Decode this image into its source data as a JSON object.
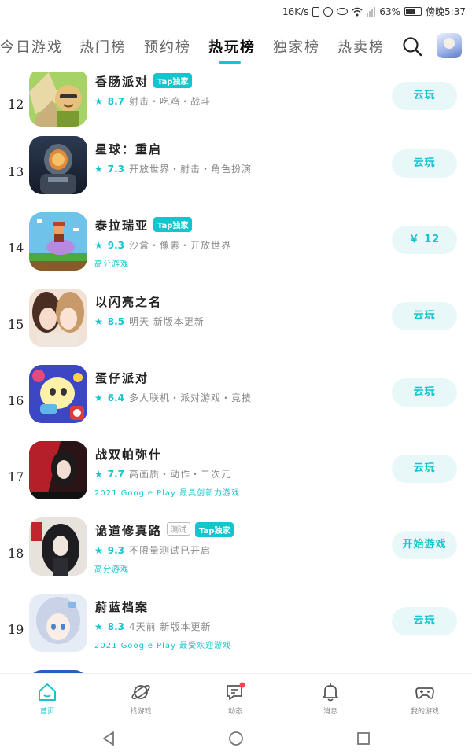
{
  "status_bar": {
    "speed": "16K/s",
    "battery_percent": "63%",
    "battery_level": 0.63,
    "time": "傍晚5:37"
  },
  "tabs": [
    {
      "label": "今日游戏",
      "active": false
    },
    {
      "label": "热门榜",
      "active": false
    },
    {
      "label": "预约榜",
      "active": false
    },
    {
      "label": "热玩榜",
      "active": true
    },
    {
      "label": "独家榜",
      "active": false
    },
    {
      "label": "热卖榜",
      "active": false
    }
  ],
  "colors": {
    "accent": "#15c5ce",
    "action_bg": "#e8f8f9"
  },
  "games": [
    {
      "rank": "12",
      "title": "香肠派对",
      "badge": "Tap独家",
      "score": "8.7",
      "tags": "射击・吃鸡・战斗",
      "extra": "",
      "action": "云玩"
    },
    {
      "rank": "13",
      "title": "星球：重启",
      "badge": "",
      "score": "7.3",
      "tags": "开放世界・射击・角色扮演",
      "extra": "",
      "action": "云玩"
    },
    {
      "rank": "14",
      "title": "泰拉瑞亚",
      "badge": "Tap独家",
      "score": "9.3",
      "tags": "沙盒・像素・开放世界",
      "extra": "高分游戏",
      "action": "￥ 12"
    },
    {
      "rank": "15",
      "title": "以闪亮之名",
      "badge": "",
      "score": "8.5",
      "tags": "明天 新版本更新",
      "extra": "",
      "action": "云玩"
    },
    {
      "rank": "16",
      "title": "蛋仔派对",
      "badge": "",
      "score": "6.4",
      "tags": "多人联机・派对游戏・竞技",
      "extra": "",
      "action": "云玩"
    },
    {
      "rank": "17",
      "title": "战双帕弥什",
      "badge": "",
      "score": "7.7",
      "tags": "高画质・动作・二次元",
      "extra": "2021 Google Play 最具创新力游戏",
      "action": "云玩"
    },
    {
      "rank": "18",
      "title": "诡道修真路",
      "badge": "Tap独家",
      "test_badge": "测试",
      "score": "9.3",
      "tags": "不限量测试已开启",
      "extra": "高分游戏",
      "action": "开始游戏"
    },
    {
      "rank": "19",
      "title": "蔚蓝档案",
      "badge": "",
      "score": "8.3",
      "tags": "4天前 新版本更新",
      "extra": "2021 Google Play 最受欢迎游戏",
      "action": "云玩"
    }
  ],
  "bottom_nav": [
    {
      "label": "首页",
      "icon": "home-icon",
      "active": true
    },
    {
      "label": "找游戏",
      "icon": "planet-icon",
      "active": false
    },
    {
      "label": "动态",
      "icon": "chat-icon",
      "active": false
    },
    {
      "label": "消息",
      "icon": "bell-icon",
      "active": false
    },
    {
      "label": "我的游戏",
      "icon": "gamepad-icon",
      "active": false
    }
  ]
}
